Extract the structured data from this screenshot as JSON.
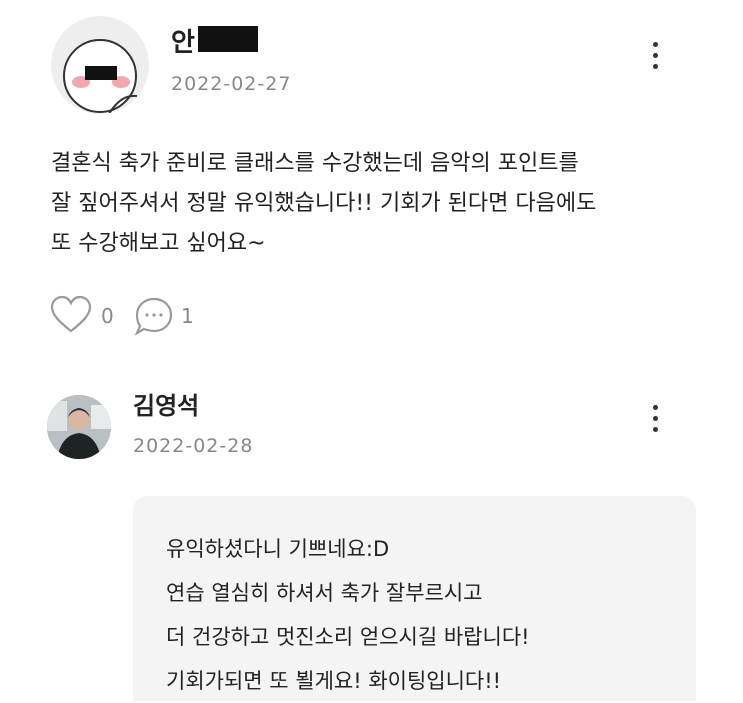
{
  "review": {
    "author": "안",
    "date": "2022-02-27",
    "body_lines": [
      "결혼식 축가 준비로 클래스를 수강했는데 음악의 포인트를",
      "잘 짚어주셔서 정말 유익했습니다!! 기회가 된다면 다음에도",
      "또 수강해보고 싶어요~"
    ],
    "like_count": "0",
    "comment_count": "1",
    "icons": {
      "menu": "more-vertical-icon",
      "like": "heart-icon",
      "comment": "speech-bubble-icon"
    }
  },
  "reply": {
    "author": "김영석",
    "date": "2022-02-28",
    "lines": [
      "유익하셨다니 기쁘네요:D",
      "연습 열심히 하셔서 축가 잘부르시고",
      "더 건강하고 멋진소리 얻으시길 바랍니다!",
      "기회가되면 또 뵐게요! 화이팅입니다!!"
    ],
    "icons": {
      "menu": "more-vertical-icon"
    }
  }
}
